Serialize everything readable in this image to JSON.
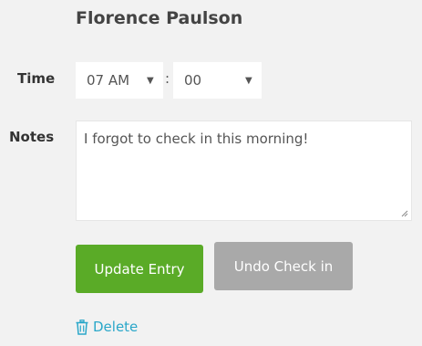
{
  "employee": {
    "name": "Florence Paulson"
  },
  "time": {
    "label": "Time",
    "hour": "07 AM",
    "separator": ":",
    "minute": "00",
    "arrow_icon": "dropdown-triangle-icon"
  },
  "notes": {
    "label": "Notes",
    "value": "I forgot to check in this morning!"
  },
  "actions": {
    "update_label": "Update Entry",
    "undo_label": "Undo Check in",
    "delete_label": "Delete",
    "delete_icon": "trash-icon"
  },
  "colors": {
    "primary_green": "#5aab27",
    "disabled_gray": "#a9a9a9",
    "link_blue": "#2aa7c9",
    "background": "#f2f2f2"
  }
}
